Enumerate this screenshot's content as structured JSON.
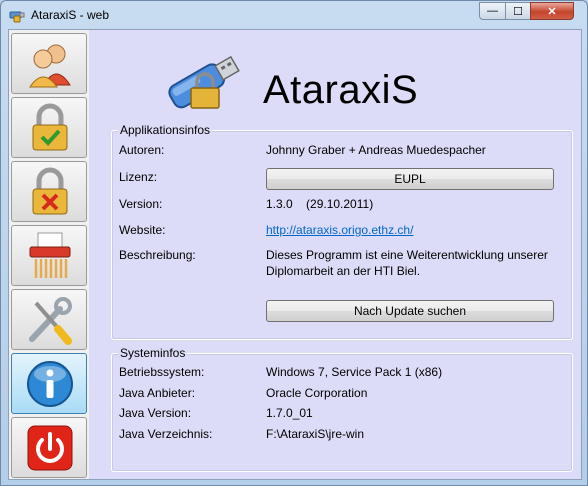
{
  "window": {
    "title": "AtaraxiS - web",
    "min_label": "—",
    "max_label": "☐",
    "close_label": "✕"
  },
  "sidebar": {
    "items": [
      {
        "name": "users",
        "icon": "users-icon"
      },
      {
        "name": "unlock",
        "icon": "lock-check-icon"
      },
      {
        "name": "lock",
        "icon": "lock-cross-icon"
      },
      {
        "name": "shredder",
        "icon": "shredder-icon"
      },
      {
        "name": "tools",
        "icon": "tools-icon"
      },
      {
        "name": "info",
        "icon": "info-icon",
        "active": true
      },
      {
        "name": "exit",
        "icon": "power-icon"
      }
    ]
  },
  "header": {
    "app_name": "AtaraxiS"
  },
  "app_info": {
    "legend": "Applikationsinfos",
    "authors_label": "Autoren:",
    "authors_value": "Johnny Graber + Andreas Muedespacher",
    "license_label": "Lizenz:",
    "license_button": "EUPL",
    "version_label": "Version:",
    "version_value": "1.3.0    (29.10.2011)",
    "website_label": "Website:",
    "website_value": "http://ataraxis.origo.ethz.ch/",
    "description_label": "Beschreibung:",
    "description_line1": "Dieses Programm ist eine Weiterentwicklung unserer",
    "description_line2": "Diplomarbeit an der HTI Biel.",
    "update_button": "Nach Update suchen"
  },
  "system_info": {
    "legend": "Systeminfos",
    "os_label": "Betriebssystem:",
    "os_value": "Windows 7, Service Pack 1 (x86)",
    "java_vendor_label": "Java Anbieter:",
    "java_vendor_value": "Oracle Corporation",
    "java_version_label": "Java Version:",
    "java_version_value": "1.7.0_01",
    "java_dir_label": "Java Verzeichnis:",
    "java_dir_value": "F:\\AtaraxiS\\jre-win"
  }
}
